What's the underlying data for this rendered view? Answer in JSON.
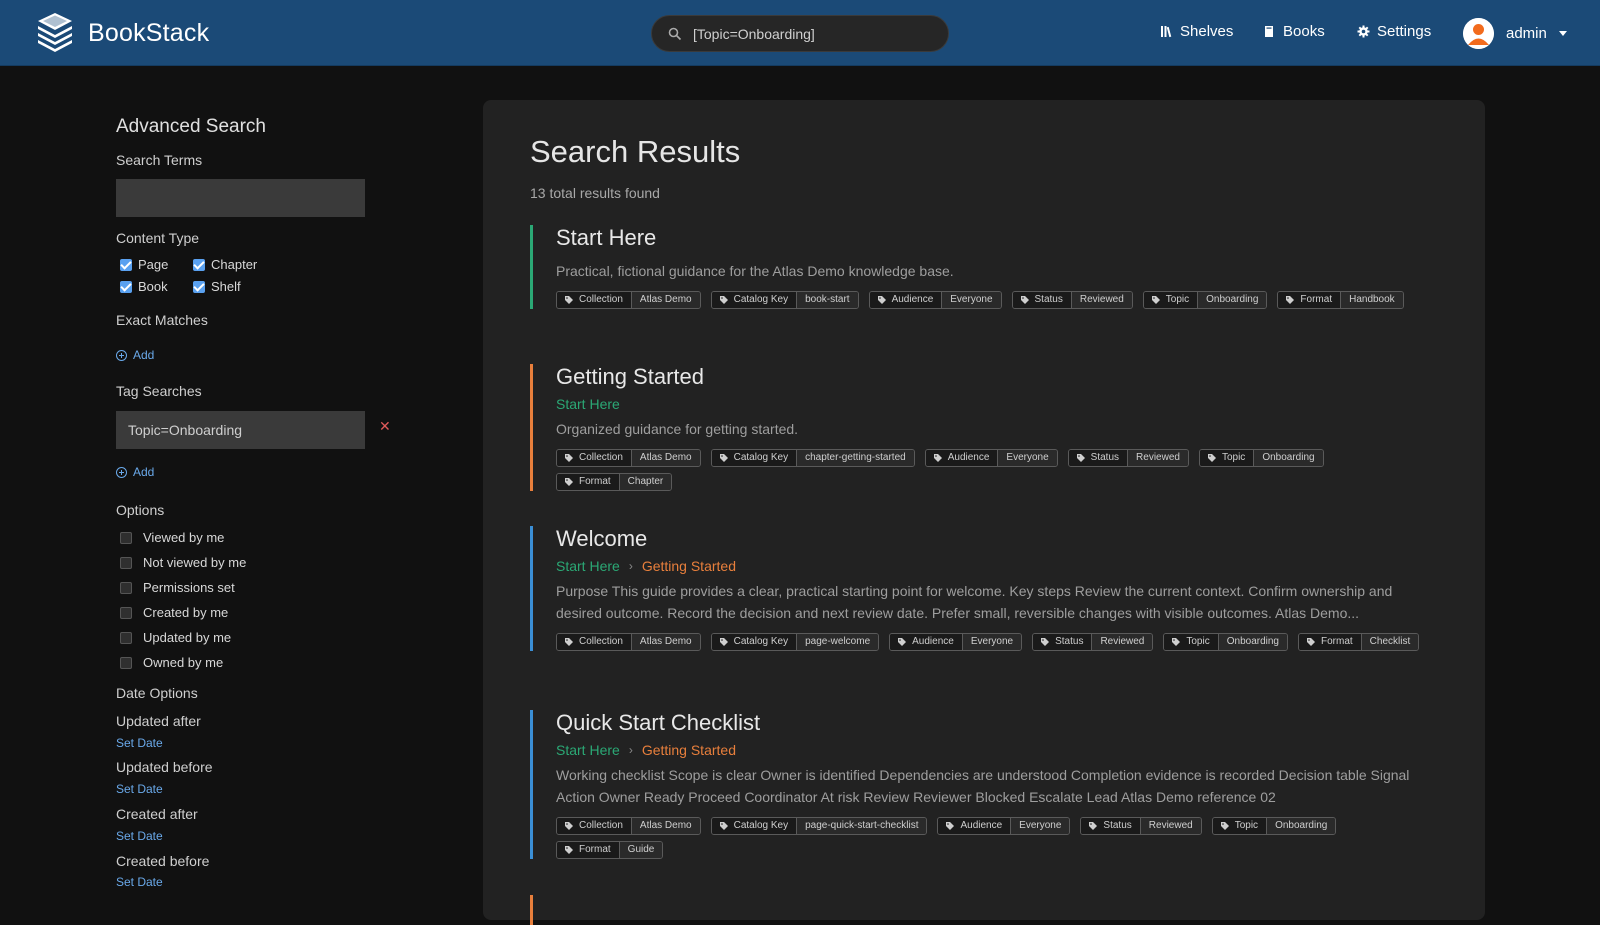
{
  "header": {
    "app_name": "BookStack",
    "search_value": "[Topic=Onboarding]",
    "nav": [
      {
        "label": "Shelves",
        "icon": "shelves-icon"
      },
      {
        "label": "Books",
        "icon": "book-icon"
      },
      {
        "label": "Settings",
        "icon": "gear-icon"
      }
    ],
    "user": "admin"
  },
  "sidebar": {
    "title": "Advanced Search",
    "search_terms_label": "Search Terms",
    "search_terms_value": "",
    "content_type_label": "Content Type",
    "content_types": [
      {
        "label": "Page",
        "checked": true
      },
      {
        "label": "Chapter",
        "checked": true
      },
      {
        "label": "Book",
        "checked": true
      },
      {
        "label": "Shelf",
        "checked": true
      }
    ],
    "exact_matches_label": "Exact Matches",
    "add_label": "Add",
    "tag_searches_label": "Tag Searches",
    "tag_search_value": "Topic=Onboarding",
    "remove_symbol": "✕",
    "options_label": "Options",
    "options": [
      "Viewed by me",
      "Not viewed by me",
      "Permissions set",
      "Created by me",
      "Updated by me",
      "Owned by me"
    ],
    "date_options_label": "Date Options",
    "date_options": [
      {
        "label": "Updated after",
        "action": "Set Date"
      },
      {
        "label": "Updated before",
        "action": "Set Date"
      },
      {
        "label": "Created after",
        "action": "Set Date"
      },
      {
        "label": "Created before",
        "action": "Set Date"
      }
    ]
  },
  "main": {
    "title": "Search Results",
    "count_text": "13 total results found",
    "results": [
      {
        "title": "Start Here",
        "type": "book",
        "bar_color": "#2ba875",
        "breadcrumb": [],
        "description": "Practical, fictional guidance for the Atlas Demo knowledge base.",
        "tags": [
          [
            "Collection",
            "Atlas Demo"
          ],
          [
            "Catalog Key",
            "book-start"
          ],
          [
            "Audience",
            "Everyone"
          ],
          [
            "Status",
            "Reviewed"
          ],
          [
            "Topic",
            "Onboarding"
          ],
          [
            "Format",
            "Handbook"
          ]
        ]
      },
      {
        "title": "Getting Started",
        "type": "chapter",
        "bar_color": "#e87f3c",
        "breadcrumb": [
          "Start Here"
        ],
        "description": "Organized guidance for getting started.",
        "tags": [
          [
            "Collection",
            "Atlas Demo"
          ],
          [
            "Catalog Key",
            "chapter-getting-started"
          ],
          [
            "Audience",
            "Everyone"
          ],
          [
            "Status",
            "Reviewed"
          ],
          [
            "Topic",
            "Onboarding"
          ],
          [
            "Format",
            "Chapter"
          ]
        ]
      },
      {
        "title": "Welcome",
        "type": "page",
        "bar_color": "#3b8fd6",
        "breadcrumb": [
          "Start Here",
          "Getting Started"
        ],
        "description": "Purpose This guide provides a clear, practical starting point for welcome. Key steps Review the current context. Confirm ownership and desired outcome. Record the decision and next review date. Prefer small, reversible changes with visible outcomes. Atlas Demo...",
        "tags": [
          [
            "Collection",
            "Atlas Demo"
          ],
          [
            "Catalog Key",
            "page-welcome"
          ],
          [
            "Audience",
            "Everyone"
          ],
          [
            "Status",
            "Reviewed"
          ],
          [
            "Topic",
            "Onboarding"
          ],
          [
            "Format",
            "Checklist"
          ]
        ]
      },
      {
        "title": "Quick Start Checklist",
        "type": "page",
        "bar_color": "#3b8fd6",
        "breadcrumb": [
          "Start Here",
          "Getting Started"
        ],
        "description": "Working checklist Scope is clear Owner is identified Dependencies are understood Completion evidence is recorded Decision table Signal Action Owner Ready Proceed Coordinator At risk Review Reviewer Blocked Escalate Lead Atlas Demo reference 02",
        "tags": [
          [
            "Collection",
            "Atlas Demo"
          ],
          [
            "Catalog Key",
            "page-quick-start-checklist"
          ],
          [
            "Audience",
            "Everyone"
          ],
          [
            "Status",
            "Reviewed"
          ],
          [
            "Topic",
            "Onboarding"
          ],
          [
            "Format",
            "Guide"
          ]
        ]
      }
    ]
  }
}
